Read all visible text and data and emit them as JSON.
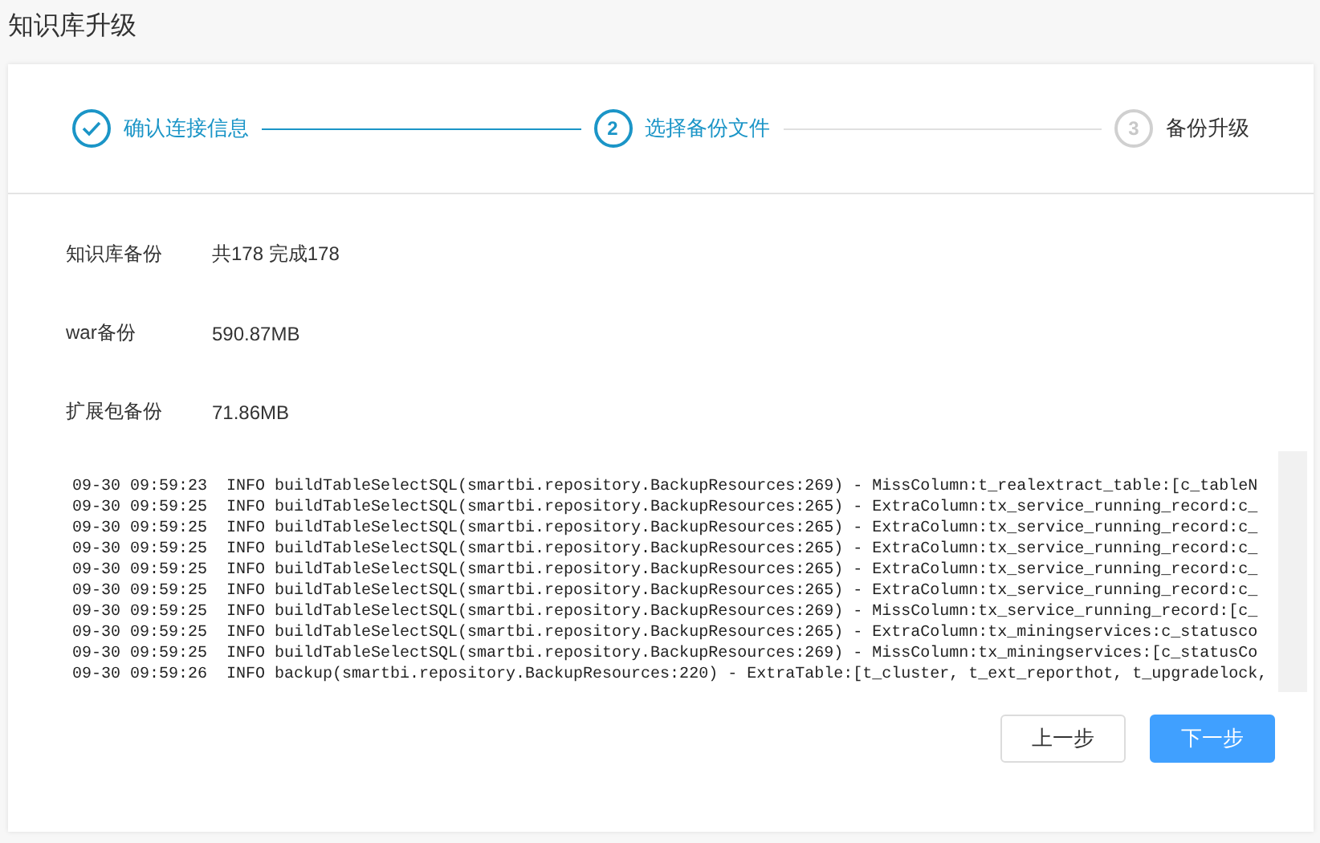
{
  "page_title": "知识库升级",
  "steps": [
    {
      "kind": "done",
      "label": "确认连接信息"
    },
    {
      "kind": "active",
      "number": "2",
      "label": "选择备份文件"
    },
    {
      "kind": "pending",
      "number": "3",
      "label": "备份升级"
    }
  ],
  "info_rows": [
    {
      "label": "知识库备份",
      "value": "共178 完成178"
    },
    {
      "label": "war备份",
      "value": "590.87MB"
    },
    {
      "label": "扩展包备份",
      "value": "71.86MB"
    }
  ],
  "log_lines": [
    "09-30 09:59:23  INFO buildTableSelectSQL(smartbi.repository.BackupResources:269) - MissColumn:t_realextract_table:[c_tableN",
    "09-30 09:59:25  INFO buildTableSelectSQL(smartbi.repository.BackupResources:265) - ExtraColumn:tx_service_running_record:c_",
    "09-30 09:59:25  INFO buildTableSelectSQL(smartbi.repository.BackupResources:265) - ExtraColumn:tx_service_running_record:c_",
    "09-30 09:59:25  INFO buildTableSelectSQL(smartbi.repository.BackupResources:265) - ExtraColumn:tx_service_running_record:c_",
    "09-30 09:59:25  INFO buildTableSelectSQL(smartbi.repository.BackupResources:265) - ExtraColumn:tx_service_running_record:c_",
    "09-30 09:59:25  INFO buildTableSelectSQL(smartbi.repository.BackupResources:265) - ExtraColumn:tx_service_running_record:c_",
    "09-30 09:59:25  INFO buildTableSelectSQL(smartbi.repository.BackupResources:269) - MissColumn:tx_service_running_record:[c_",
    "09-30 09:59:25  INFO buildTableSelectSQL(smartbi.repository.BackupResources:265) - ExtraColumn:tx_miningservices:c_statusco",
    "09-30 09:59:25  INFO buildTableSelectSQL(smartbi.repository.BackupResources:269) - MissColumn:tx_miningservices:[c_statusCo",
    "09-30 09:59:26  INFO backup(smartbi.repository.BackupResources:220) - ExtraTable:[t_cluster, t_ext_reporthot, t_upgradelock,"
  ],
  "buttons": [
    {
      "kind": "secondary",
      "label": "上一步"
    },
    {
      "kind": "primary",
      "label": "下一步"
    }
  ]
}
